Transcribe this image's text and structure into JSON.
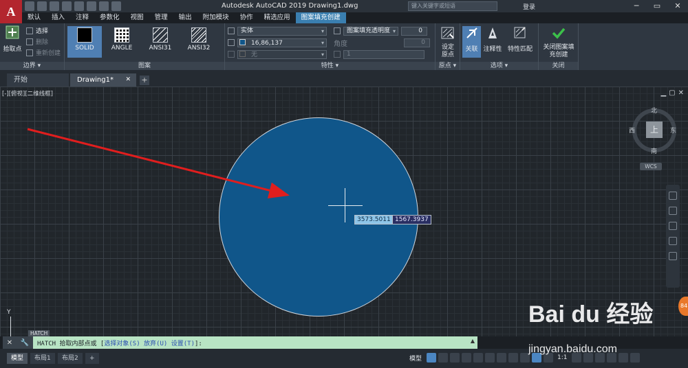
{
  "titlebar": {
    "app_logo": "A",
    "title": "Autodesk AutoCAD 2019    Drawing1.dwg",
    "search_placeholder": "键入关键字或短语",
    "login": "登录",
    "win_min": "─",
    "win_max": "▭",
    "win_close": "✕"
  },
  "ribbon_tabs": [
    "默认",
    "插入",
    "注释",
    "参数化",
    "视图",
    "管理",
    "输出",
    "附加模块",
    "协作",
    "精选应用",
    "图案填充创建"
  ],
  "ribbon": {
    "boundary": {
      "pick_points": "拾取点",
      "select": "选择",
      "remove": "删除",
      "recreate": "重新创建",
      "title": "边界 ▾"
    },
    "pattern": {
      "items": [
        "SOLID",
        "ANGLE",
        "ANSI31",
        "ANSI32"
      ],
      "title": "图案"
    },
    "properties": {
      "type": "实体",
      "color": "16,86,137",
      "background": "无",
      "transparency_label": "图案填充透明度",
      "transparency_value": "0",
      "angle_label": "角度",
      "angle_value": "0",
      "scale_value": "1",
      "title": "特性 ▾"
    },
    "origin": {
      "set_origin": "设定原点",
      "title": "原点 ▾"
    },
    "options": {
      "associative": "关联",
      "annotative": "注释性",
      "match_props": "特性匹配",
      "title": "选项 ▾"
    },
    "close": {
      "label": "关闭图案填充创建",
      "title": "关闭"
    }
  },
  "doc_tabs": {
    "start": "开始",
    "drawing": "Drawing1*",
    "drawing_close": "✕",
    "add": "+"
  },
  "canvas": {
    "viewport_label": "[-][俯视][二维线框]",
    "ctrl": [
      "▁",
      "▢",
      "✕"
    ],
    "coord_x": "3573.5011",
    "coord_y": "1567.3937",
    "hatch_color": "#10568a"
  },
  "viewcube": {
    "north": "北",
    "south": "南",
    "east": "东",
    "west": "西",
    "face": "上",
    "wcs": "WCS"
  },
  "ucs": {
    "y_label": "Y",
    "badge": "HATCH"
  },
  "side_badge": "84",
  "command": {
    "prefix": "HATCH 拾取内部点或 [",
    "opt1": "选择对象(S)",
    "sep1": " ",
    "opt2": "放弃(U)",
    "sep2": " ",
    "opt3": "设置(T)",
    "suffix": "]:"
  },
  "status": {
    "tabs": [
      "模型",
      "布局1",
      "布局2"
    ],
    "add": "+",
    "model": "模型",
    "scale": "1:1"
  },
  "watermark": {
    "text": "Bai du 经验",
    "url": "jingyan.baidu.com"
  },
  "arrow_color": "#e01e1e"
}
